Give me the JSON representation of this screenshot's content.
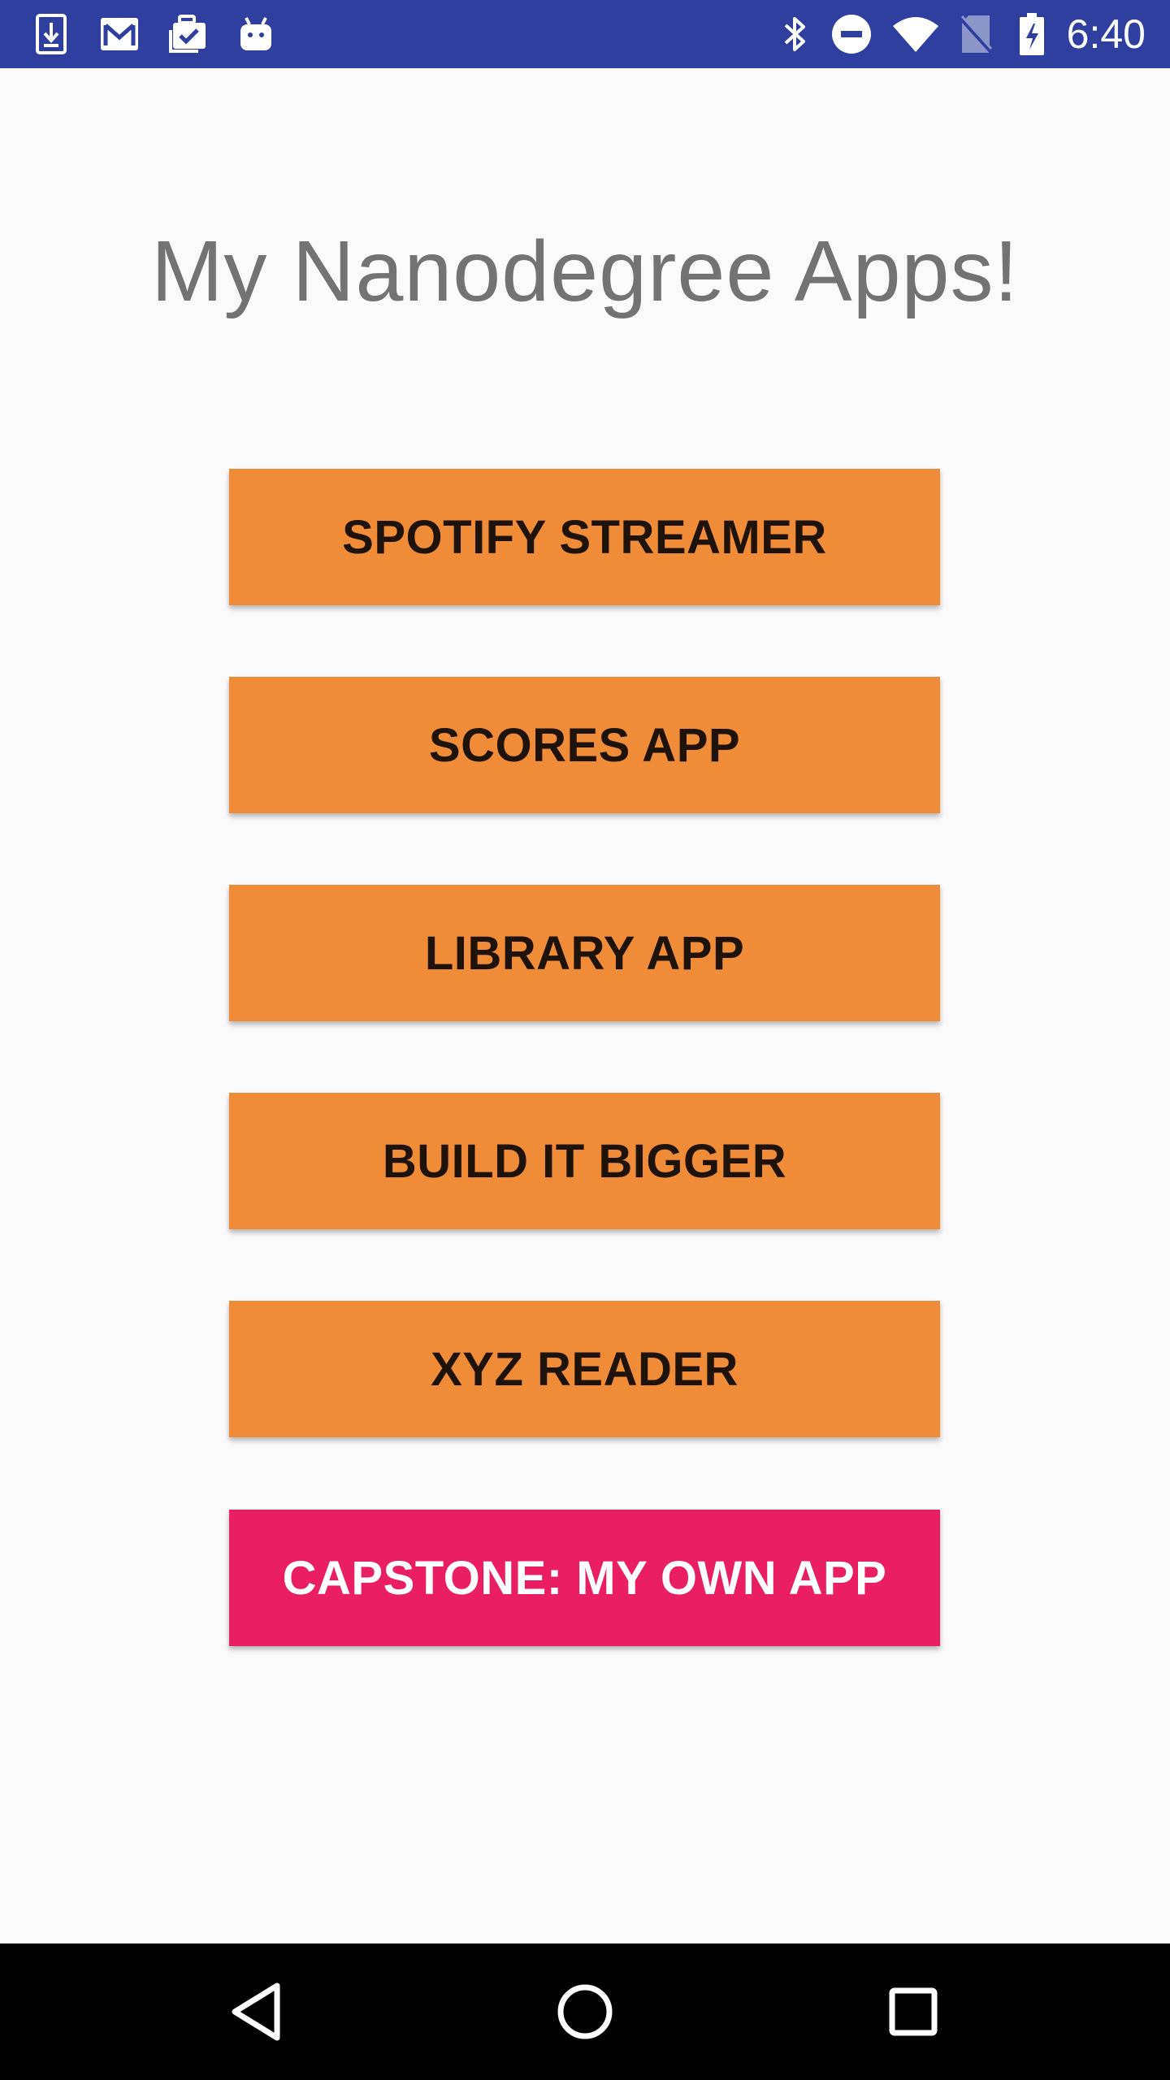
{
  "status_bar": {
    "time": "6:40",
    "left_icons": [
      "download-icon",
      "gmail-icon",
      "tasks-icon",
      "android-icon"
    ],
    "right_icons": [
      "bluetooth-icon",
      "do-not-disturb-icon",
      "wifi-icon",
      "no-sim-icon",
      "battery-charging-icon"
    ],
    "background": "#303f9f"
  },
  "main": {
    "title": "My Nanodegree Apps!",
    "buttons": [
      {
        "label": "SPOTIFY STREAMER",
        "color": "#f08c38"
      },
      {
        "label": "SCORES APP",
        "color": "#f08c38"
      },
      {
        "label": "LIBRARY APP",
        "color": "#f08c38"
      },
      {
        "label": "BUILD IT BIGGER",
        "color": "#f08c38"
      },
      {
        "label": "XYZ READER",
        "color": "#f08c38"
      },
      {
        "label": "CAPSTONE: MY OWN APP",
        "color": "#e91e63"
      }
    ]
  },
  "nav_bar": {
    "icons": [
      "back-icon",
      "home-icon",
      "recents-icon"
    ]
  }
}
